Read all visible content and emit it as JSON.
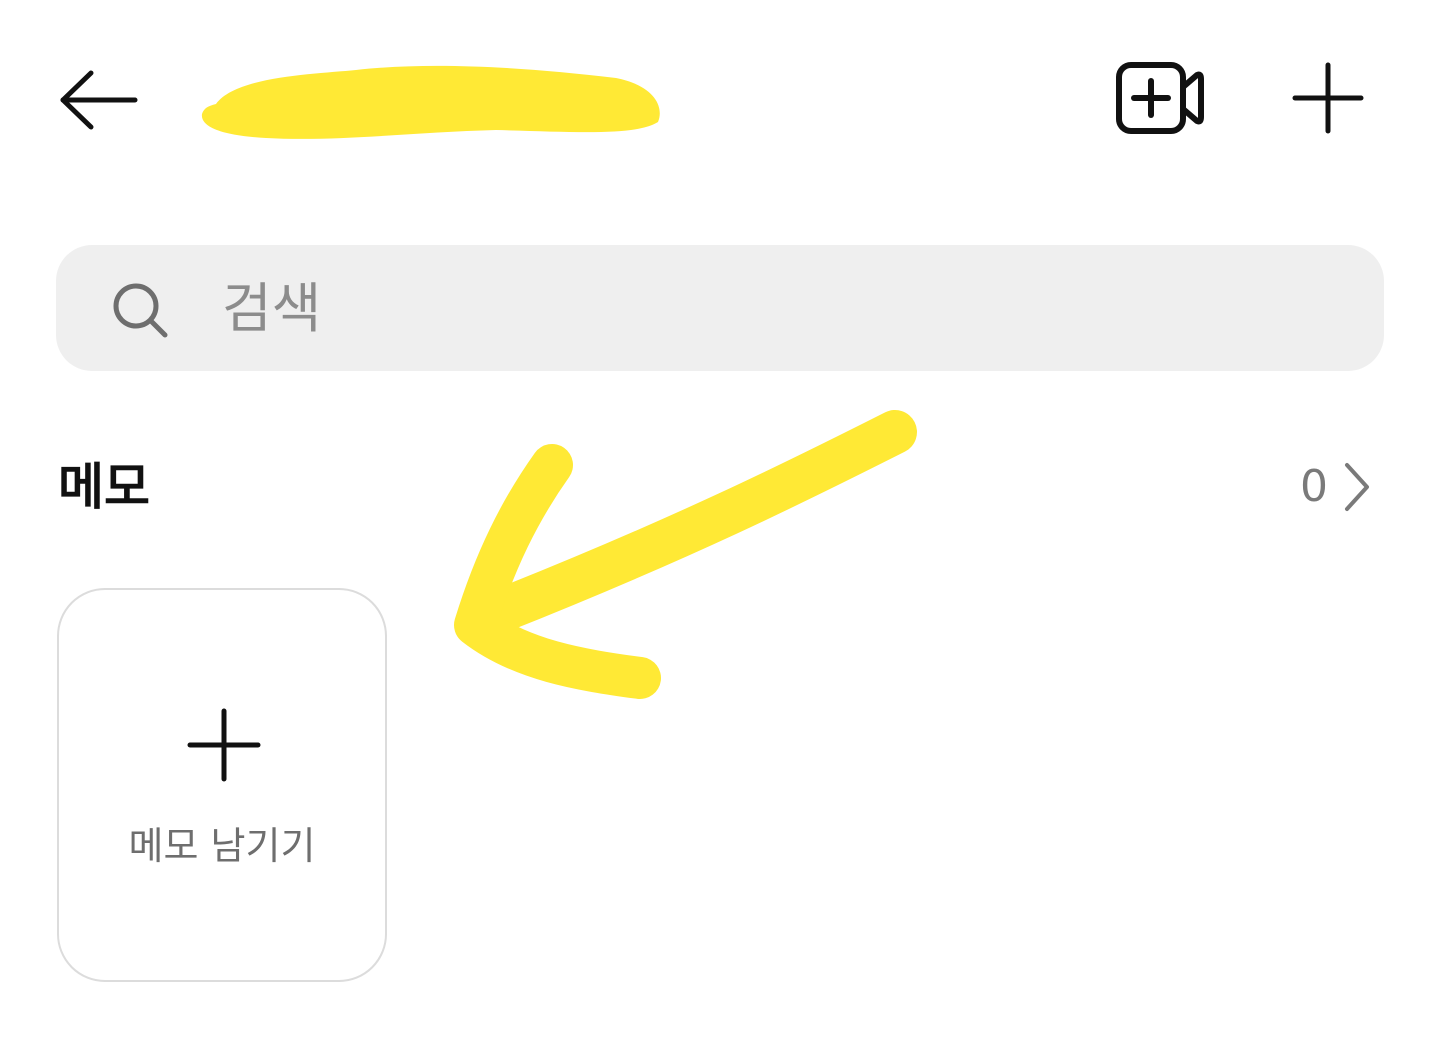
{
  "header": {
    "back_icon": "arrow-left-icon",
    "title": "",
    "video_icon": "video-call-add-icon",
    "new_icon": "plus-icon"
  },
  "search": {
    "placeholder": "검색",
    "icon": "search-icon"
  },
  "memo_section": {
    "title": "메모",
    "count": "0",
    "chevron_icon": "chevron-right-icon",
    "add_card": {
      "icon": "plus-icon",
      "label": "메모 남기기"
    }
  },
  "colors": {
    "highlight": "#ffe935",
    "search_bg": "#efefef",
    "muted_text": "#7a7a7a",
    "card_border": "#dcdcdc"
  }
}
